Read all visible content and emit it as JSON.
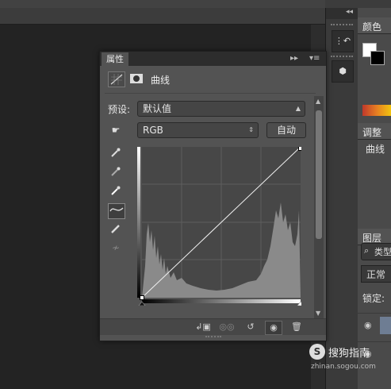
{
  "panel": {
    "tab": "属性",
    "menu_icon": "panel-menu-icon",
    "collapse_icon": "double-arrow-right-icon",
    "title": "曲线",
    "preset_label": "预设:",
    "preset_value": "默认值",
    "channel_value": "RGB",
    "auto_label": "自动"
  },
  "tools": [
    "curve-adjust-hand-icon",
    "eyedropper-black-icon",
    "eyedropper-gray-icon",
    "eyedropper-white-icon",
    "curve-point-tool-icon",
    "pencil-draw-icon",
    "smooth-curve-icon"
  ],
  "footer_icons": [
    "clip-to-layer-icon",
    "view-previous-state-icon",
    "reset-icon",
    "visibility-eye-icon",
    "trash-icon"
  ],
  "dock": {
    "collapse_icon": "collapse-double-arrow-icon",
    "buttons": [
      "history-icon",
      "properties-3d-icon"
    ]
  },
  "right_panels": {
    "color_tab": "颜色",
    "adjust_tab": "调整",
    "adjust_label": "曲线",
    "layers_tab": "图层",
    "search_text": "类型",
    "blend_mode": "正常",
    "lock_label": "锁定:"
  },
  "watermark": {
    "text": "搜狗指南",
    "url": "zhinan.sogou.com"
  },
  "colors": {
    "foreground": "#ffffff",
    "background": "#000000"
  }
}
